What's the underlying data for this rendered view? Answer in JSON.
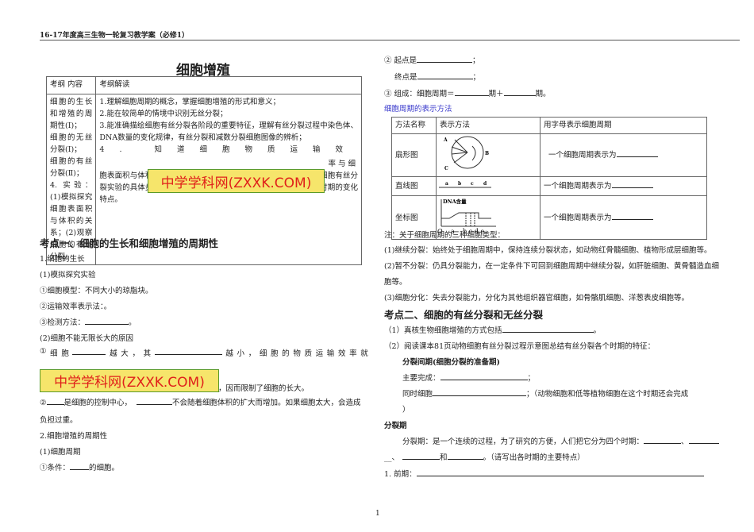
{
  "header": "16-17年度高三生物一轮复习教学案（必修1）",
  "title": "细胞增殖",
  "watermark": "中学学科网(ZXXK.COM)",
  "syllabus": {
    "col1_head": "考纲 内容",
    "col2_head": "考纲解读",
    "col1": [
      "细胞的生长和增殖的周期性(Ⅰ)；",
      "细胞的无丝分裂(Ⅰ)；",
      "细胞的有丝分裂(Ⅱ)；",
      "4. 实验：(1)模拟探究细胞表面积与体积的关系；(2)观察细胞的有丝分裂。"
    ],
    "col2": [
      "1.理解细胞周期的概念，掌握细胞增殖的形式和意义；",
      "2.能在较简单的情境中识别无丝分裂；",
      "3.能准确描绘细胞有丝分裂各阶段的重要特征，理解有丝分裂过程中染色体、DNA数量的变化规律，有丝分裂和减数分裂细胞图像的辨析；",
      "4. 知道细胞物质运输效",
      "率与细",
      "胞表面积与体积比的关系、明确实验的目的与原理；掌握观察植物细胞有丝分裂实验的具体步骤，结合有丝分裂过程中染色体的行为变化理解各时期的变化特点。"
    ]
  },
  "left": {
    "sec1": "考点一、细胞的生长和细胞增殖的周期性",
    "l1": "1.细胞的生长",
    "l2": "(1)模拟探究实验",
    "l3": "①细胞模型：不同大小的琼脂块。",
    "l4": "②运输效率表示法：。",
    "l5a": "③检测方法：",
    "l5b": "。",
    "l6": "(2)细胞不能无限长大的原因",
    "l7": [
      "①",
      "细",
      "胞",
      "越",
      "大",
      "，",
      "其",
      "越",
      "小",
      "，",
      "细",
      "胞",
      "的",
      "物",
      "质",
      "运",
      "输",
      "效",
      "率",
      "就"
    ],
    "l8": "，因而限制了细胞的长大。",
    "l9a": "②",
    "l9b": "是细胞的控制中心，",
    "l9c": "不会随着细胞体积的扩大而增加。如果细胞太大，会造成",
    "l10": "负担过重。",
    "l11": "2.细胞增殖的周期性",
    "l12": "(1)细胞周期",
    "l13a": "①条件：",
    "l13b": "的细胞。"
  },
  "right": {
    "r1a": "② 起点是",
    "r1b": "；",
    "r2a": "终点是",
    "r2b": "；",
    "r3a": "③ 组成：细胞周期＝",
    "r3b": "期＋",
    "r3c": "期。",
    "blue": "细胞周期的表示方法",
    "table": {
      "head": [
        "方法名称",
        "表示方法",
        "用字母表示细胞周期"
      ],
      "rows": [
        "扇形图",
        "直线图",
        "坐标图"
      ],
      "answer": "一个细胞周期表示为",
      "fan_labels": [
        "A",
        "B",
        "C"
      ],
      "line_labels": [
        "a",
        "b",
        "c",
        "d"
      ],
      "coord_ylabel": "DNA含量",
      "coord_xlabels": [
        "O",
        "a",
        "b c d e"
      ]
    },
    "n0": "注：关于细胞周期的三种细胞类型：",
    "n1": "(1)继续分裂：始终处于细胞周期中，保持连续分裂状态，如动物红骨髓细胞、植物形成层细胞等。",
    "n2": "(2)暂不分裂：仍具分裂能力，在一定条件下可回到细胞周期中继续分裂，如肝脏细胞、黄骨髓造血细",
    "n2b": "胞等。",
    "n3": "(3)细胞分化：失去分裂能力，分化为其他组织器官细胞，如骨骼肌细胞、洋葱表皮细胞等。",
    "sec2": "考点二、细胞的有丝分裂和无丝分裂",
    "p1a": "（1）真核生物细胞增殖的方式包括",
    "p1b": "。",
    "p2": "（2）阅读课本81页动物细胞有丝分裂过程示意图总结有丝分裂各个时期的特征：",
    "p3": "分裂间期(细胞分裂的准备期)",
    "p4a": "主要完成：",
    "p4b": "；",
    "p5a": "同时细胞",
    "p5b": "；（动物细胞和低等植物细胞在这个时期还会完成",
    "p6": "）",
    "p7": "分裂期",
    "p8": "分裂期：是一个连续的过程，为了研究的方便，人们把它分为四个时期：",
    "p8b": "、",
    "p9a": "__、",
    "p9b": "和",
    "p9c": "。（请写出各时期的主要特点）",
    "p10": "1.  前期："
  },
  "page_number": "1"
}
